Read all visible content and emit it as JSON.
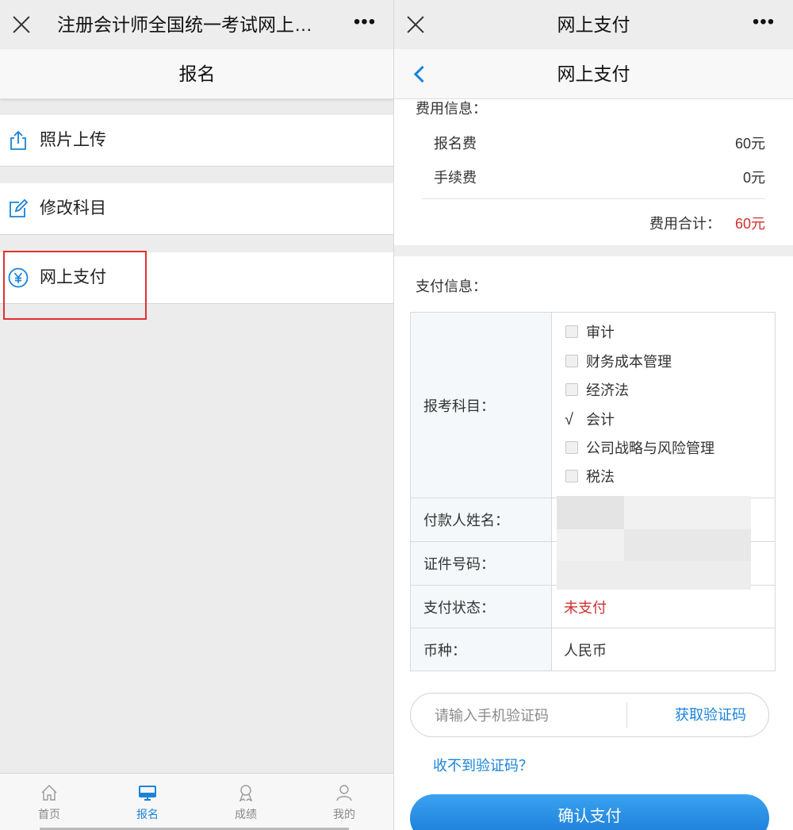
{
  "left": {
    "titlebar": {
      "title": "注册会计师全国统一考试网上…",
      "more": "•••"
    },
    "header": {
      "title": "报名"
    },
    "menu": [
      {
        "label": "照片上传",
        "icon": "upload-icon"
      },
      {
        "label": "修改科目",
        "icon": "edit-icon"
      },
      {
        "label": "网上支付",
        "icon": "yuan-icon"
      }
    ],
    "nav": [
      {
        "label": "首页",
        "icon": "home-icon",
        "active": false
      },
      {
        "label": "报名",
        "icon": "monitor-icon",
        "active": true
      },
      {
        "label": "成绩",
        "icon": "award-icon",
        "active": false
      },
      {
        "label": "我的",
        "icon": "user-icon",
        "active": false
      }
    ]
  },
  "right": {
    "titlebar": {
      "title": "网上支付",
      "more": "•••"
    },
    "header": {
      "title": "网上支付"
    },
    "fee": {
      "section_title": "费用信息：",
      "rows": [
        {
          "label": "报名费",
          "value": "60元"
        },
        {
          "label": "手续费",
          "value": "0元"
        }
      ],
      "total_label": "费用合计：",
      "total_value": "60元"
    },
    "payment": {
      "section_title": "支付信息：",
      "subject_label": "报考科目：",
      "subjects": [
        {
          "name": "审计",
          "checked": false
        },
        {
          "name": "财务成本管理",
          "checked": false
        },
        {
          "name": "经济法",
          "checked": false
        },
        {
          "name": "会计",
          "checked": true
        },
        {
          "name": "公司战略与风险管理",
          "checked": false
        },
        {
          "name": "税法",
          "checked": false
        }
      ],
      "check_mark": "√",
      "payer_label": "付款人姓名：",
      "id_label": "证件号码：",
      "status_label": "支付状态：",
      "status_value": "未支付",
      "currency_label": "币种：",
      "currency_value": "人民币"
    },
    "verify": {
      "placeholder": "请输入手机验证码",
      "get_code": "获取验证码",
      "no_code": "收不到验证码？"
    },
    "confirm": "确认支付"
  },
  "colors": {
    "accent": "#1a83d8",
    "alert": "#d0312d",
    "highlight_box": "#e0312d"
  }
}
